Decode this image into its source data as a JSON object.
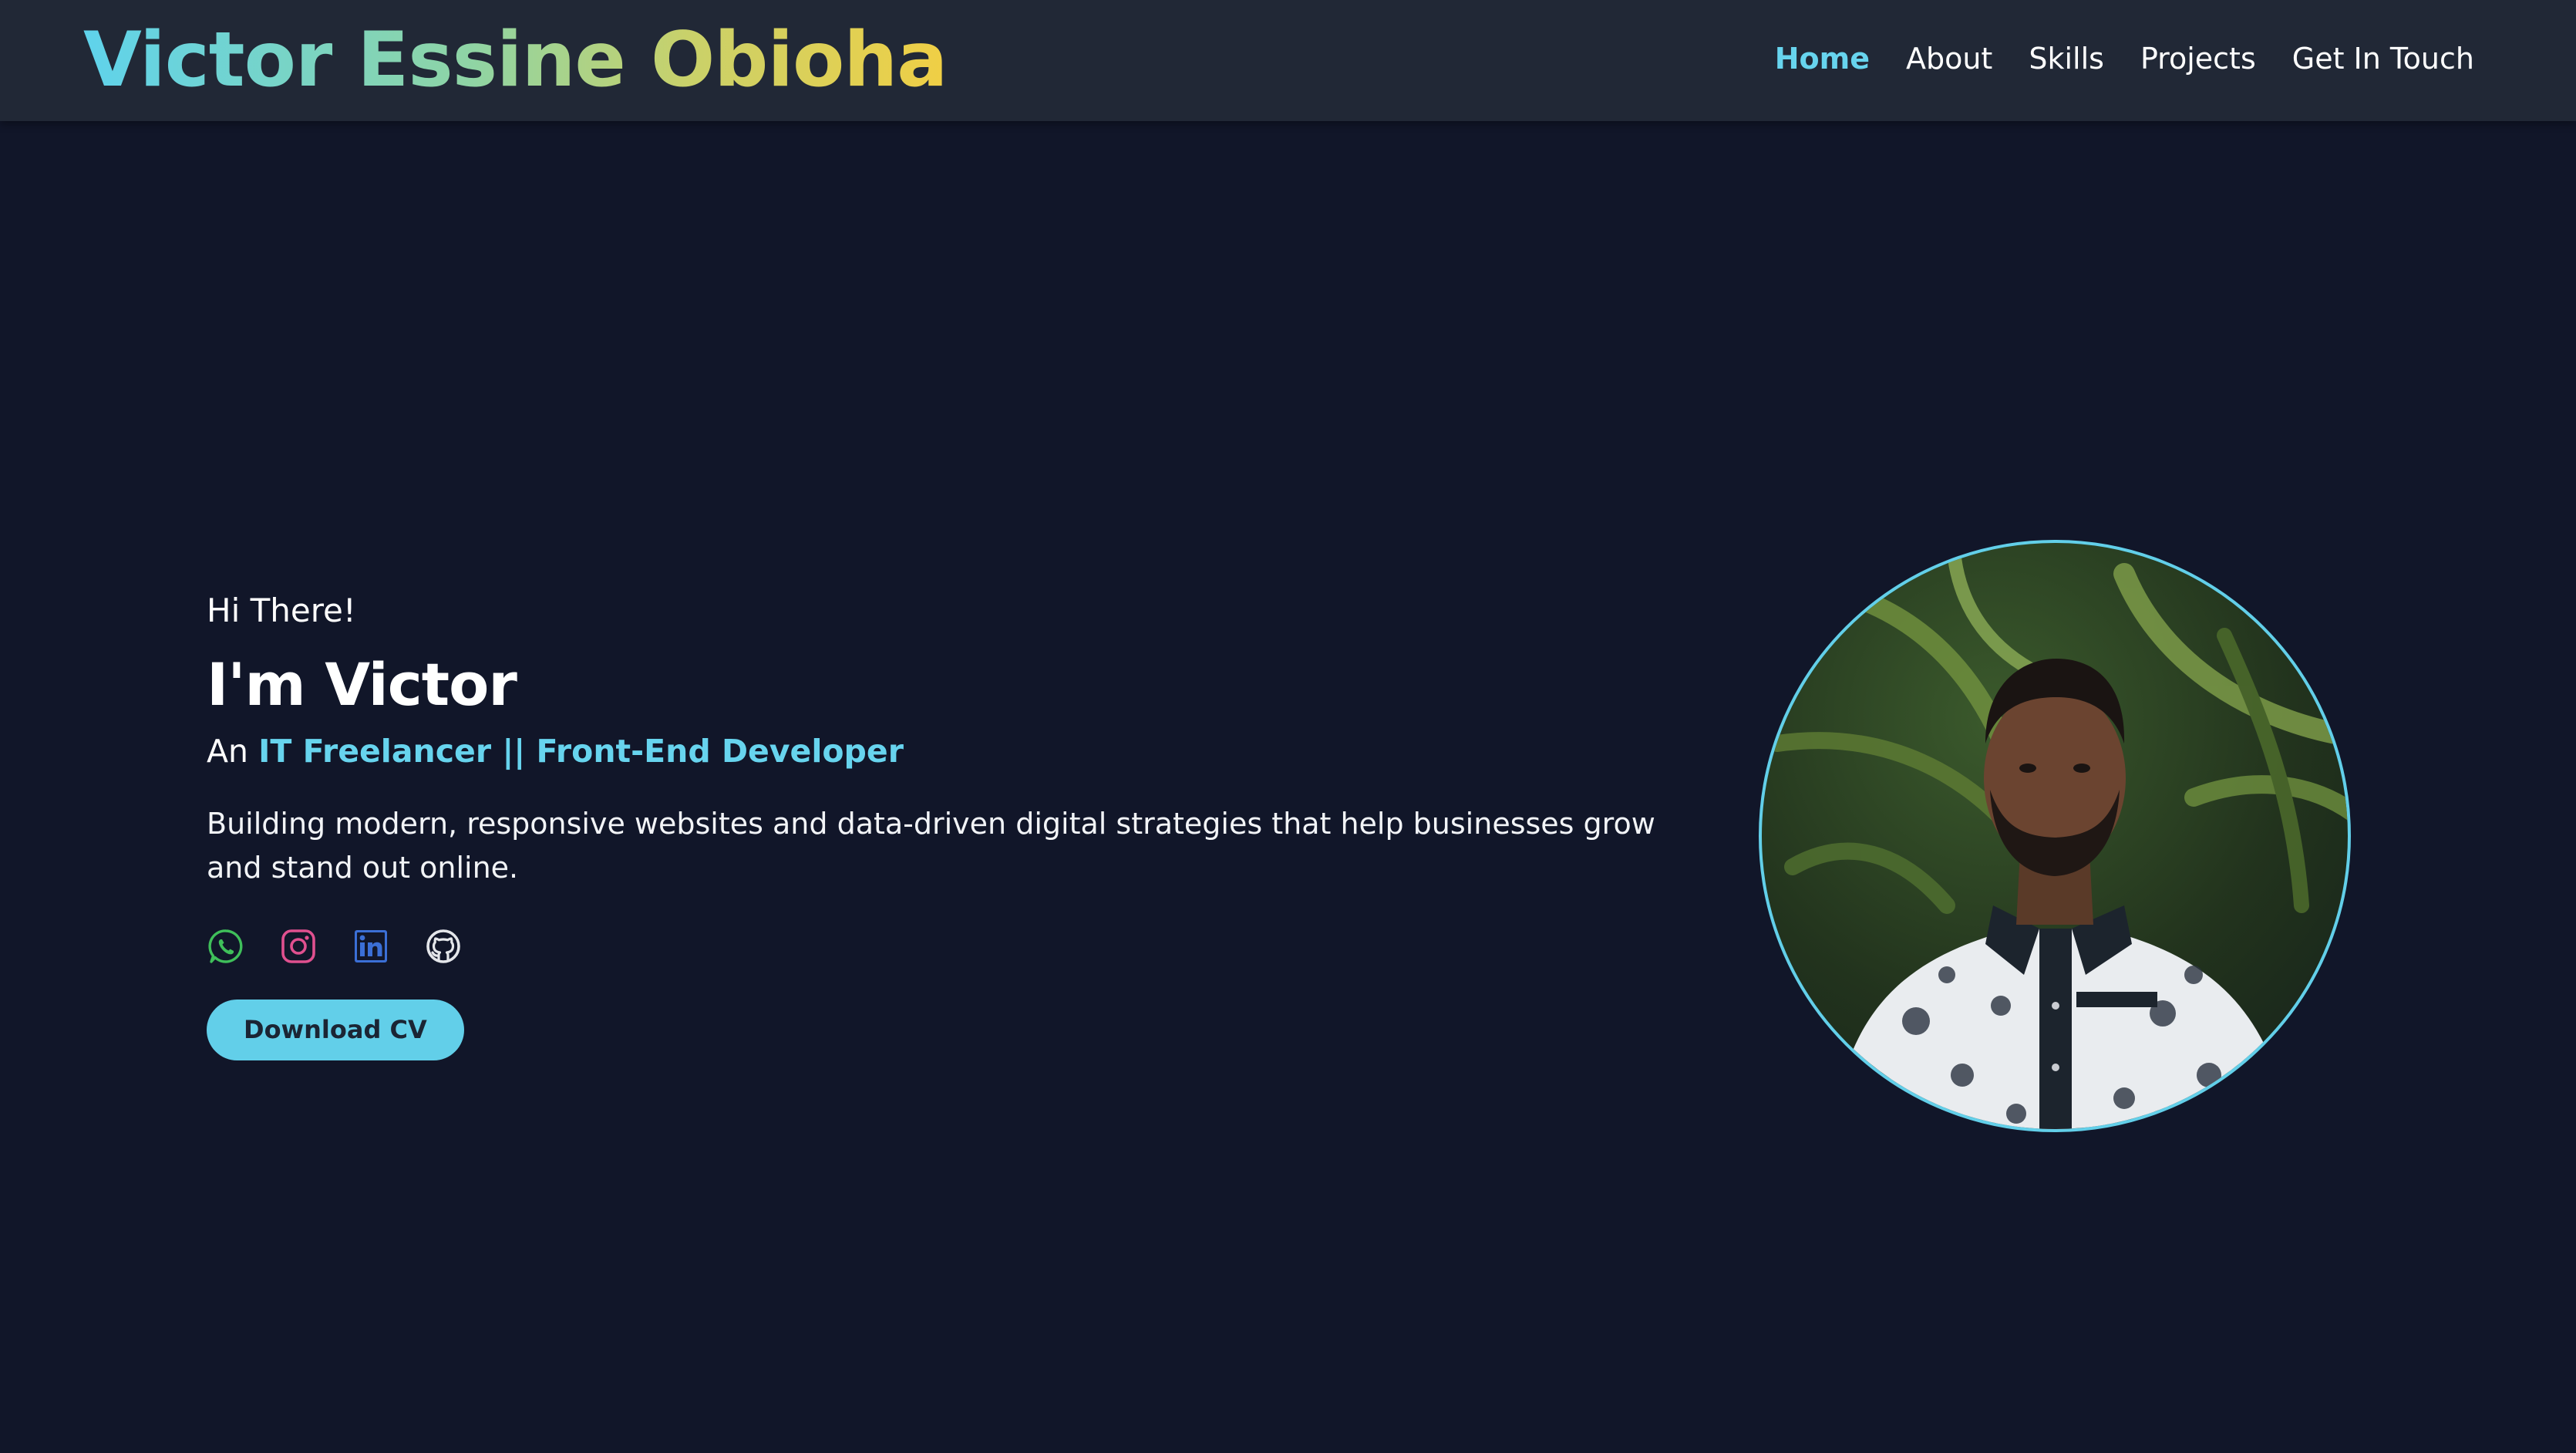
{
  "header": {
    "logo_text": "Victor Essine Obioha",
    "nav": [
      {
        "label": "Home",
        "active": true
      },
      {
        "label": "About",
        "active": false
      },
      {
        "label": "Skills",
        "active": false
      },
      {
        "label": "Projects",
        "active": false
      },
      {
        "label": "Get In Touch",
        "active": false
      }
    ]
  },
  "hero": {
    "greeting": "Hi There!",
    "name": "I'm Victor",
    "role_prefix": "An",
    "role_accent": "IT Freelancer || Front-End Developer",
    "description": "Building modern, responsive websites and data-driven digital strategies that help businesses grow and stand out online.",
    "socials": [
      {
        "icon": "whatsapp-icon",
        "color": "#3fbf5a"
      },
      {
        "icon": "instagram-icon",
        "color": "#e0508f"
      },
      {
        "icon": "linkedin-icon",
        "color": "#3b6fd6"
      },
      {
        "icon": "github-icon",
        "color": "#e4e6ea"
      }
    ],
    "cta_label": "Download CV"
  },
  "colors": {
    "background": "#111629",
    "header": "#212836",
    "accent": "#67d4ee",
    "button": "#62cfe9"
  }
}
